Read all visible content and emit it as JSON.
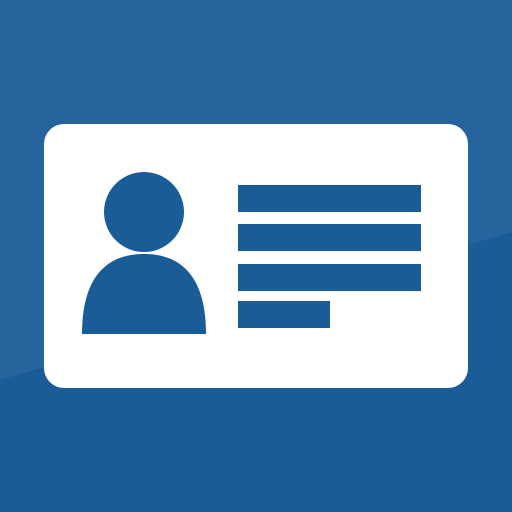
{
  "icon": {
    "name": "id-card-icon",
    "background_color": "#1a5c98",
    "card_color": "#ffffff",
    "glyph_color": "#1a5c98"
  },
  "card": {
    "avatar_icon": "person-icon",
    "text_line_icons": [
      "text-line",
      "text-line",
      "text-line",
      "text-line-short"
    ]
  }
}
